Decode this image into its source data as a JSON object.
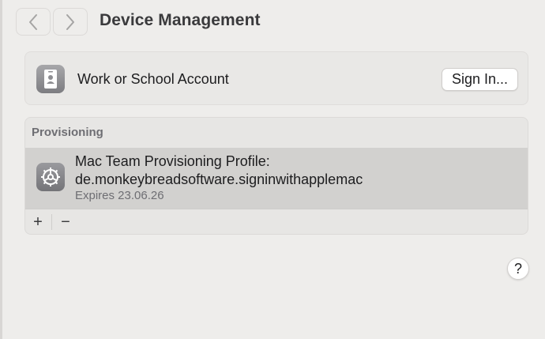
{
  "header": {
    "title": "Device Management",
    "back_icon": "chevron-left-icon",
    "forward_icon": "chevron-right-icon"
  },
  "account": {
    "icon": "id-badge-icon",
    "label": "Work or School Account",
    "sign_in_label": "Sign In..."
  },
  "provisioning": {
    "header": "Provisioning",
    "profiles": [
      {
        "icon": "gear-icon",
        "name_line1": "Mac Team Provisioning Profile:",
        "name_line2": "de.monkeybreadsoftware.signinwithapplemac",
        "expiry": "Expires 23.06.26"
      }
    ],
    "add_label": "+",
    "remove_label": "−"
  },
  "help": {
    "label": "?"
  },
  "colors": {
    "window_bg": "#eeedeb",
    "selected_row": "#d2d1cf"
  }
}
